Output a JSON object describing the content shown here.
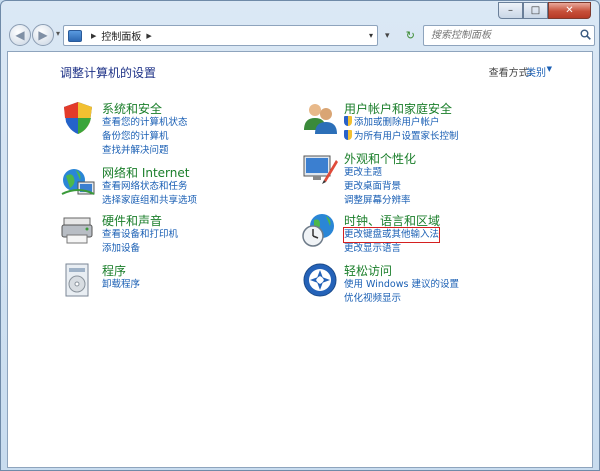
{
  "caption": {
    "minimize": "–",
    "maximize": "□",
    "close": "✕"
  },
  "nav": {
    "back": "◀",
    "forward": "▶",
    "history": "▾",
    "address_separator": "▶",
    "address_path": "控制面板",
    "address_trailing_separator": "▶",
    "address_dropdown": "▾",
    "search_placeholder": "搜索控制面板",
    "refresh_dropdown": "▾",
    "refresh_icon": "↻"
  },
  "header": {
    "title": "调整计算机的设置",
    "view_by_label": "查看方式:",
    "view_by_value": "类别",
    "view_by_arrow": "▼"
  },
  "categories": [
    {
      "title": "系统和安全",
      "icon": "system-security-icon",
      "links": [
        "查看您的计算机状态",
        "备份您的计算机",
        "查找并解决问题"
      ]
    },
    {
      "title": "网络和 Internet",
      "icon": "network-internet-icon",
      "links": [
        "查看网络状态和任务",
        "选择家庭组和共享选项"
      ]
    },
    {
      "title": "硬件和声音",
      "icon": "hardware-sound-icon",
      "links": [
        "查看设备和打印机",
        "添加设备"
      ]
    },
    {
      "title": "程序",
      "icon": "programs-icon",
      "links": [
        "卸载程序"
      ]
    },
    {
      "title": "用户帐户和家庭安全",
      "icon": "user-accounts-icon",
      "links": [
        "添加或删除用户帐户",
        "为所有用户设置家长控制"
      ]
    },
    {
      "title": "外观和个性化",
      "icon": "appearance-icon",
      "links": [
        "更改主题",
        "更改桌面背景",
        "调整屏幕分辨率"
      ]
    },
    {
      "title": "时钟、语言和区域",
      "icon": "clock-language-region-icon",
      "links": [
        "更改键盘或其他输入法",
        "更改显示语言"
      ]
    },
    {
      "title": "轻松访问",
      "icon": "ease-of-access-icon",
      "links": [
        "使用 Windows 建议的设置",
        "优化视频显示"
      ]
    }
  ],
  "colors": {
    "category_title": "#1a7e2a",
    "link": "#1a5fb4",
    "page_title": "#1e3287",
    "highlight": "#d42020"
  }
}
